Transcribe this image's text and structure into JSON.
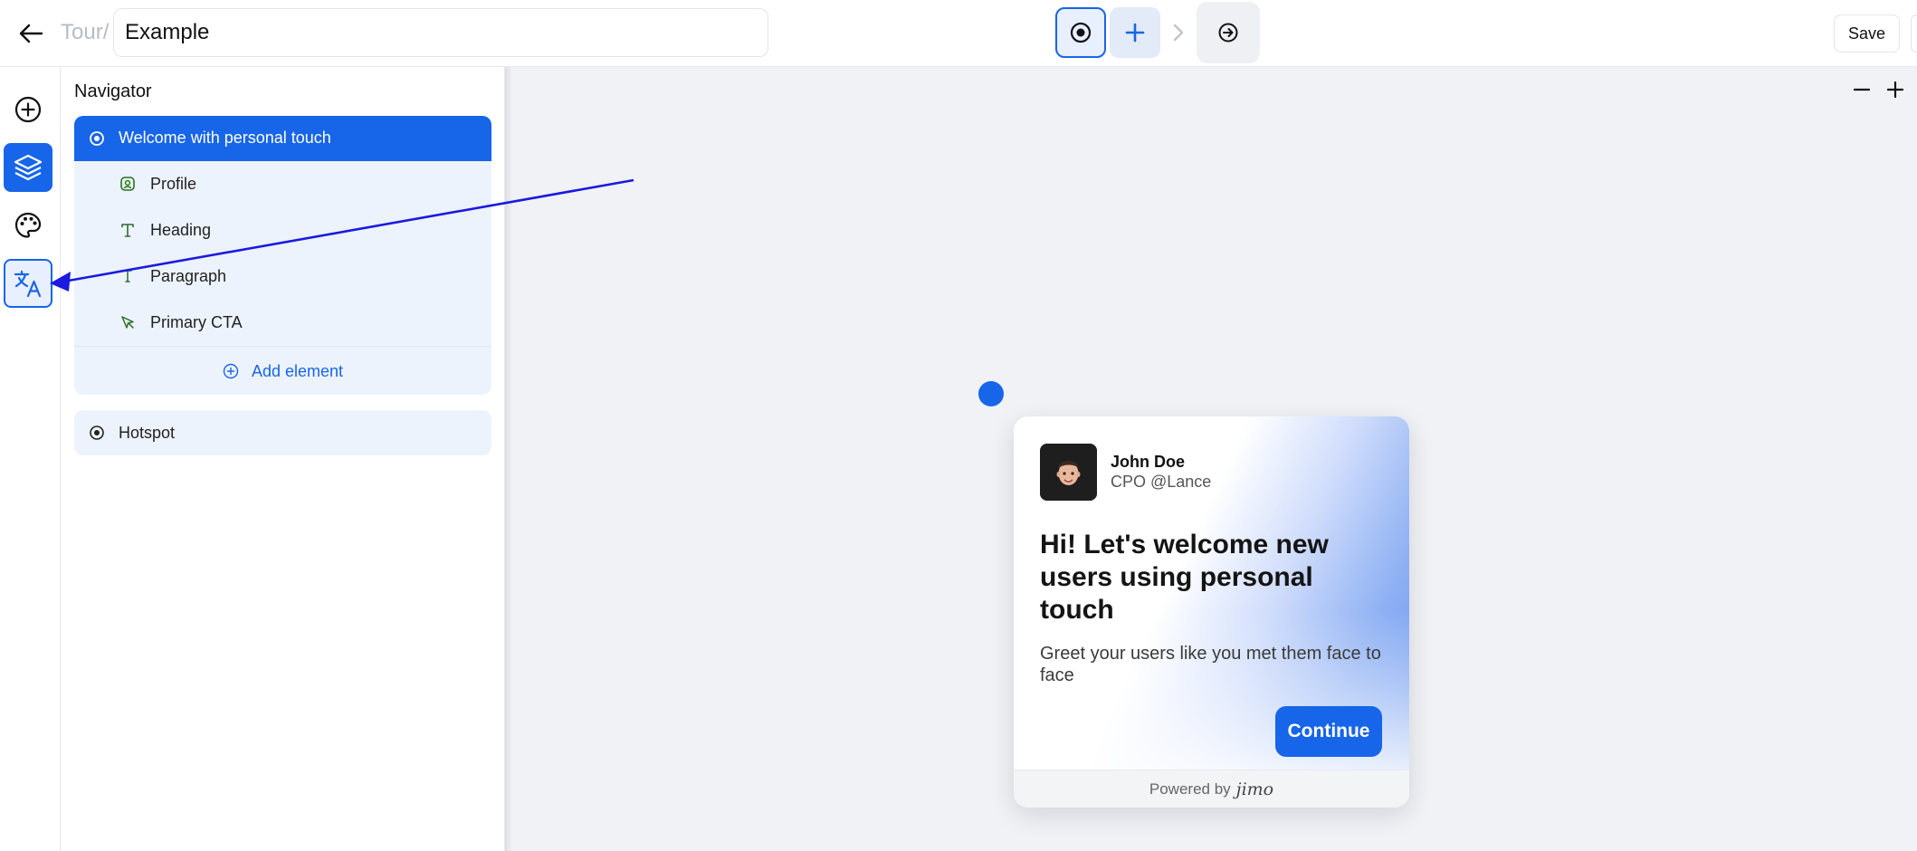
{
  "topbar": {
    "breadcrumb": "Tour/",
    "title_value": "Example",
    "save_label": "Save"
  },
  "rail": {
    "items": [
      {
        "name": "add",
        "icon": "plus-circle-icon"
      },
      {
        "name": "navigator",
        "icon": "layers-icon",
        "state": "active"
      },
      {
        "name": "theme",
        "icon": "palette-icon"
      },
      {
        "name": "translate",
        "icon": "translate-icon",
        "state": "selected"
      }
    ]
  },
  "navigator": {
    "title": "Navigator",
    "step_label": "Welcome with personal touch",
    "elements": [
      {
        "label": "Profile",
        "icon": "profile-icon"
      },
      {
        "label": "Heading",
        "icon": "text-icon"
      },
      {
        "label": "Paragraph",
        "icon": "paragraph-icon"
      },
      {
        "label": "Primary CTA",
        "icon": "cursor-icon"
      }
    ],
    "add_element_label": "Add element",
    "hotspot_label": "Hotspot"
  },
  "card": {
    "author_name": "John Doe",
    "author_role": "CPO @Lance",
    "heading": "Hi! Let's welcome new users using personal touch",
    "text": "Greet your users like you met them face to face",
    "cta_label": "Continue",
    "footer_prefix": "Powered by",
    "footer_brand": "jimo"
  },
  "colors": {
    "accent": "#1765e8",
    "canvas_bg": "#f1f2f5",
    "nav_group_bg": "#edf3fd",
    "annotation_arrow": "#1a1ae0"
  }
}
